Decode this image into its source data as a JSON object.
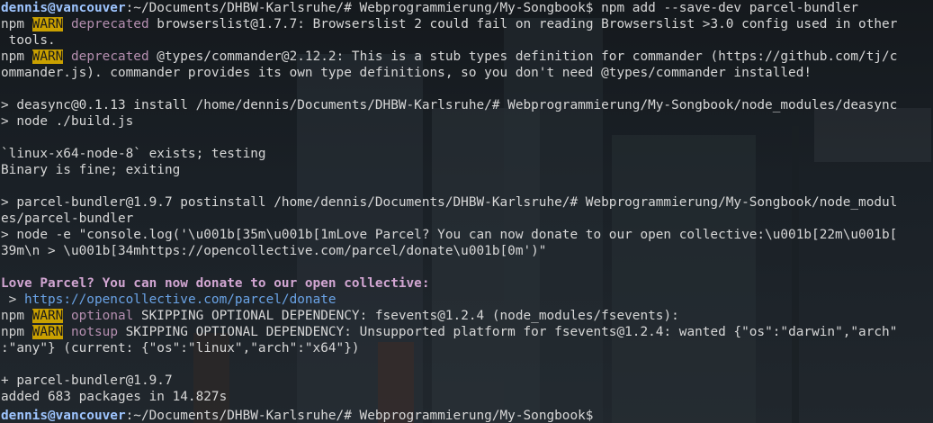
{
  "terminal": {
    "prompt_user": "dennis@vancouver",
    "prompt_sep": ":",
    "lines": [
      {
        "type": "prompt",
        "path": "~/Documents/DHBW-Karlsruhe/# Webprogrammierung/My-Songbook$",
        "cmd": " npm add --save-dev parcel-bundler"
      },
      {
        "type": "warn",
        "npm": "npm",
        "badge": "WARN",
        "kind": "deprecated",
        "text": " browserslist@1.7.7: Browserslist 2 could fail on reading Browserslist >3.0 config used in other"
      },
      {
        "type": "plain",
        "text": " tools."
      },
      {
        "type": "warn",
        "npm": "npm",
        "badge": "WARN",
        "kind": "deprecated",
        "text": " @types/commander@2.12.2: This is a stub types definition for commander (https://github.com/tj/c"
      },
      {
        "type": "plain",
        "text": "ommander.js). commander provides its own type definitions, so you don't need @types/commander installed!"
      },
      {
        "type": "plain",
        "text": ""
      },
      {
        "type": "plain",
        "text": "> deasync@0.1.13 install /home/dennis/Documents/DHBW-Karlsruhe/# Webprogrammierung/My-Songbook/node_modules/deasync"
      },
      {
        "type": "plain",
        "text": "> node ./build.js"
      },
      {
        "type": "plain",
        "text": ""
      },
      {
        "type": "plain",
        "text": "`linux-x64-node-8` exists; testing"
      },
      {
        "type": "plain",
        "text": "Binary is fine; exiting"
      },
      {
        "type": "plain",
        "text": ""
      },
      {
        "type": "plain",
        "text": "> parcel-bundler@1.9.7 postinstall /home/dennis/Documents/DHBW-Karlsruhe/# Webprogrammierung/My-Songbook/node_modul"
      },
      {
        "type": "plain",
        "text": "es/parcel-bundler"
      },
      {
        "type": "plain",
        "text": "> node -e \"console.log('\\u001b[35m\\u001b[1mLove Parcel? You can now donate to our open collective:\\u001b[22m\\u001b["
      },
      {
        "type": "plain",
        "text": "39m\\n > \\u001b[34mhttps://opencollective.com/parcel/donate\\u001b[0m')\""
      },
      {
        "type": "plain",
        "text": ""
      },
      {
        "type": "love",
        "text": "Love Parcel? You can now donate to our open collective:"
      },
      {
        "type": "link",
        "prefix": " > ",
        "text": "https://opencollective.com/parcel/donate"
      },
      {
        "type": "warn",
        "npm": "npm",
        "badge": "WARN",
        "kind": "optional",
        "text": " SKIPPING OPTIONAL DEPENDENCY: fsevents@1.2.4 (node_modules/fsevents):"
      },
      {
        "type": "warn",
        "npm": "npm",
        "badge": "WARN",
        "kind": "notsup",
        "text": " SKIPPING OPTIONAL DEPENDENCY: Unsupported platform for fsevents@1.2.4: wanted {\"os\":\"darwin\",\"arch\""
      },
      {
        "type": "plain",
        "text": ":\"any\"} (current: {\"os\":\"linux\",\"arch\":\"x64\"})"
      },
      {
        "type": "plain",
        "text": ""
      },
      {
        "type": "plain",
        "text": "+ parcel-bundler@1.9.7"
      },
      {
        "type": "plain",
        "text": "added 683 packages in 14.827s"
      },
      {
        "type": "prompt",
        "path": "~/Documents/DHBW-Karlsruhe/# Webprogrammierung/My-Songbook$",
        "cmd": ""
      }
    ]
  },
  "colors": {
    "warn_bg": "#c9a000",
    "prompt_user": "#9ec5ff",
    "warn_kind": "#b58fb0",
    "love": "#d2a6d2",
    "link": "#6aa3e6"
  }
}
